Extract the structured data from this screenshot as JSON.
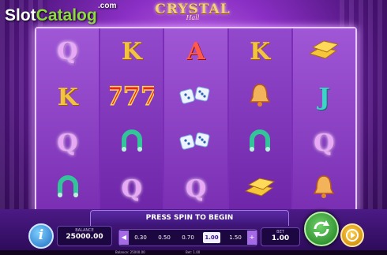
{
  "watermark": {
    "slot": "Slot",
    "catalog": "Catalog",
    "dotcom": ".com"
  },
  "game_title": {
    "main": "CRYSTAL",
    "sub": "Hall"
  },
  "reels": [
    [
      {
        "symbol": "Q",
        "kind": "letter"
      },
      {
        "symbol": "K",
        "kind": "letter"
      },
      {
        "symbol": "Q",
        "kind": "letter"
      },
      {
        "symbol": "horseshoe",
        "kind": "icon"
      }
    ],
    [
      {
        "symbol": "K",
        "kind": "letter"
      },
      {
        "symbol": "777",
        "kind": "icon"
      },
      {
        "symbol": "horseshoe",
        "kind": "icon"
      },
      {
        "symbol": "Q",
        "kind": "letter"
      }
    ],
    [
      {
        "symbol": "A",
        "kind": "letter"
      },
      {
        "symbol": "dice",
        "kind": "icon"
      },
      {
        "symbol": "dice",
        "kind": "icon"
      },
      {
        "symbol": "Q",
        "kind": "letter"
      }
    ],
    [
      {
        "symbol": "K",
        "kind": "letter"
      },
      {
        "symbol": "bell",
        "kind": "icon"
      },
      {
        "symbol": "horseshoe",
        "kind": "icon"
      },
      {
        "symbol": "gold-bars",
        "kind": "icon"
      }
    ],
    [
      {
        "symbol": "gold-bars",
        "kind": "icon"
      },
      {
        "symbol": "J",
        "kind": "letter"
      },
      {
        "symbol": "Q",
        "kind": "letter"
      },
      {
        "symbol": "bell",
        "kind": "icon"
      }
    ]
  ],
  "message": "PRESS SPIN TO BEGIN",
  "info_icon": "i",
  "balance": {
    "label": "BALANCE",
    "value": "25000.00"
  },
  "bet_options": [
    "0.30",
    "0.50",
    "0.70",
    "1.00",
    "1.50"
  ],
  "bet_selected": "1.00",
  "bet_arrows": {
    "decrease": "◀",
    "increase": "+"
  },
  "bet": {
    "label": "BET",
    "value": "1.00"
  },
  "status": {
    "balance": "Balance: 25000.00",
    "bet": "Bet: 1.00"
  },
  "icons": {
    "spin": "refresh-arrows-icon",
    "autoplay": "play-icon",
    "info": "info-icon"
  },
  "colors": {
    "accent": "#8a2fc4",
    "spin": "#2f9b2b",
    "autoplay": "#f3a21a"
  }
}
